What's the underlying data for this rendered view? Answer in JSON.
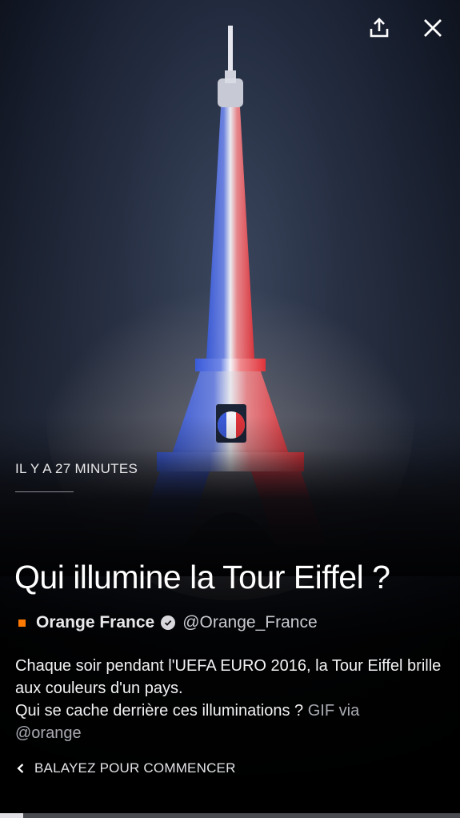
{
  "header": {
    "share_icon": "share-icon",
    "close_icon": "close-icon"
  },
  "story": {
    "timestamp": "IL Y A 27 MINUTES",
    "title": "Qui illumine la Tour Eiffel ?",
    "author": {
      "brand_color": "#ff7900",
      "name": "Orange France",
      "verified_icon": "verified-badge-icon",
      "handle": "@Orange_France"
    },
    "body_line1": "Chaque soir pendant l'UEFA EURO 2016, la Tour Eiffel brille aux couleurs d'un pays.",
    "body_line2": "Qui se cache derrière ces illuminations ?",
    "body_credit": "GIF via",
    "body_handle": "@orange"
  },
  "footer": {
    "swipe_label": "BALAYEZ POUR COMMENCER",
    "swipe_icon": "chevron-left-icon",
    "progress": 0.05
  },
  "colors": {
    "tower_blue": "#3a5bd9",
    "tower_white": "#f4f4f8",
    "tower_red": "#e0333a"
  }
}
